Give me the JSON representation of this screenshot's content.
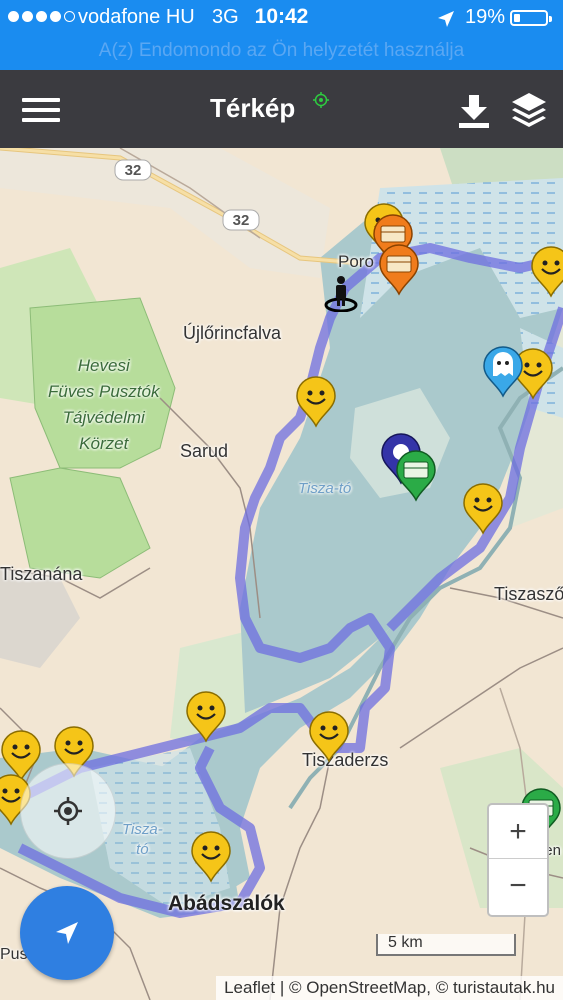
{
  "status_bar": {
    "carrier": "vodafone HU",
    "network": "3G",
    "time": "10:42",
    "battery": "19%",
    "battery_level": 0.19,
    "location_banner": "A(z) Endomondo az Ön helyzetét használja",
    "bar_color": "#1a8cf0"
  },
  "app_bar": {
    "title": "Térkép",
    "menu_icon": "hamburger-menu-icon",
    "gps_icon": "gps-indicator-icon",
    "download_icon": "download-icon",
    "layers_icon": "layers-icon"
  },
  "map": {
    "road_shields": [
      "32",
      "32"
    ],
    "places": [
      {
        "name": "Poro",
        "key": "poroszlo"
      },
      {
        "name": "Újlőrincfalva",
        "key": "ujlorincfalva"
      },
      {
        "name": "Sarud",
        "key": "sarud"
      },
      {
        "name": "Tiszanána",
        "key": "tiszanana"
      },
      {
        "name": "Tiszaszől",
        "key": "tiszaszolos"
      },
      {
        "name": "Tiszaderzs",
        "key": "tiszaderzs"
      },
      {
        "name": "Abádszalók",
        "key": "abadszalok"
      },
      {
        "name": "Tiszaszen",
        "key": "tiszaszentimre"
      },
      {
        "name": "Pusztataskony",
        "key": "pusztataskony"
      }
    ],
    "nature_reserve": "Hevesi\nFüves Pusztók\nTájvédelmi\nKörzet",
    "water_labels": [
      "Tisza-tó",
      "Tisza-\ntó"
    ],
    "route_color": "#6b6bde",
    "marker_types": [
      "smiley-marker",
      "orange-chest-marker",
      "green-chest-marker",
      "ghost-marker",
      "blue-poi-marker",
      "user-position-marker"
    ]
  },
  "controls": {
    "zoom_in": "+",
    "zoom_out": "−",
    "scale": "5 km",
    "attribution": "Leaflet | © OpenStreetMap, © turistautak.hu"
  }
}
